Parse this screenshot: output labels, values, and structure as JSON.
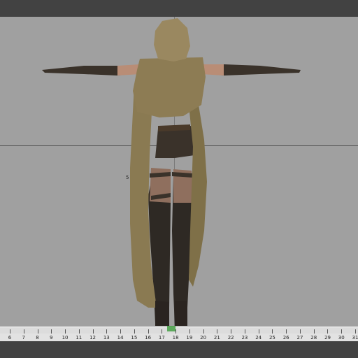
{
  "viewport": {
    "frame_marker": "5"
  },
  "timeline": {
    "ticks": [
      "6",
      "7",
      "8",
      "9",
      "10",
      "11",
      "12",
      "13",
      "14",
      "15",
      "16",
      "17",
      "18",
      "19",
      "20",
      "21",
      "22",
      "23",
      "24",
      "25",
      "26",
      "27",
      "28",
      "29",
      "30",
      "31"
    ]
  },
  "colors": {
    "background": "#a0a0a0",
    "cloak": "#8a7a52",
    "clothing": "#3a322a",
    "skin": "#b98d76",
    "bars": "#424242"
  }
}
